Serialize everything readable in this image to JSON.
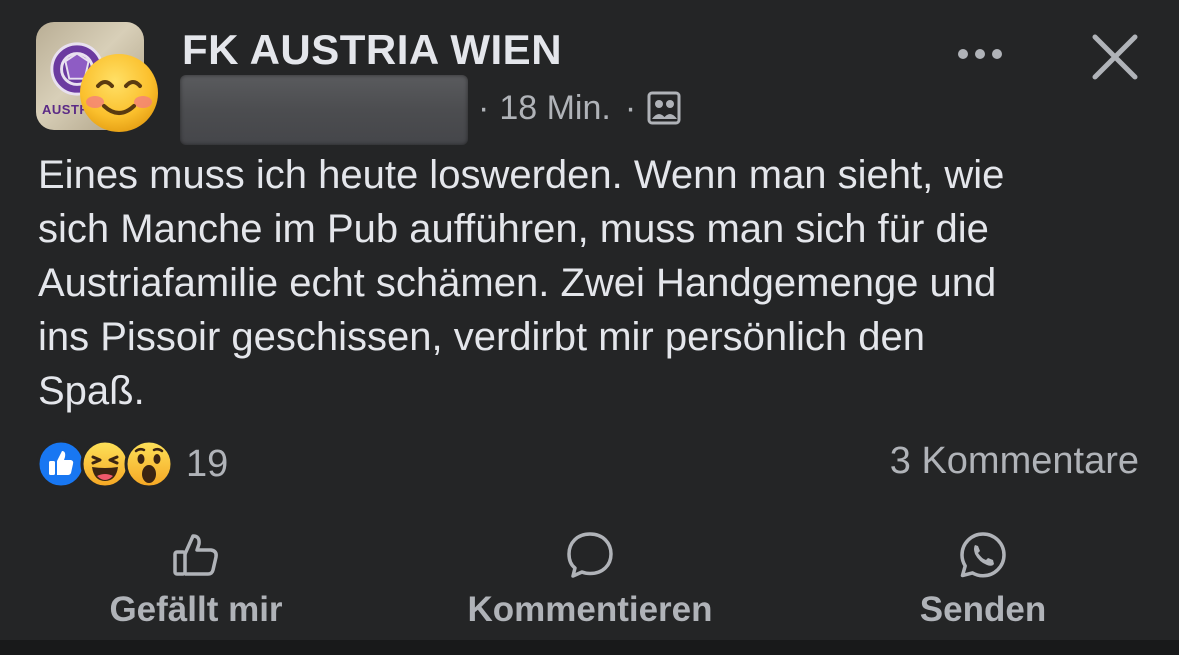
{
  "post": {
    "page_name": "FK AUSTRIA WIEN",
    "meta": {
      "separator": "·",
      "time": "18 Min.",
      "audience_icon": "group-audience-icon"
    },
    "avatar": {
      "crest_text": "AUSTRIA",
      "overlay_emoji": "smiling-face-icon"
    },
    "text_lines": [
      "Eines muss ich heute loswerden. Wenn man sieht, wie",
      "sich Manche im Pub aufführen, muss man sich für die",
      "Austriafamilie echt schämen. Zwei Handgemenge und",
      "ins Pissoir geschissen, verdirbt mir persönlich den",
      "Spaß."
    ],
    "reactions": {
      "icons": [
        "like",
        "haha",
        "wow"
      ],
      "count": "19"
    },
    "comments_label": "3 Kommentare"
  },
  "actions": {
    "like": "Gefällt mir",
    "comment": "Kommentieren",
    "send": "Senden"
  },
  "colors": {
    "background": "#242526",
    "primary_text": "#e4e6eb",
    "secondary_text": "#b0b3b8",
    "like_blue": "#1877f2",
    "reaction_yellow": "#f7b125"
  }
}
